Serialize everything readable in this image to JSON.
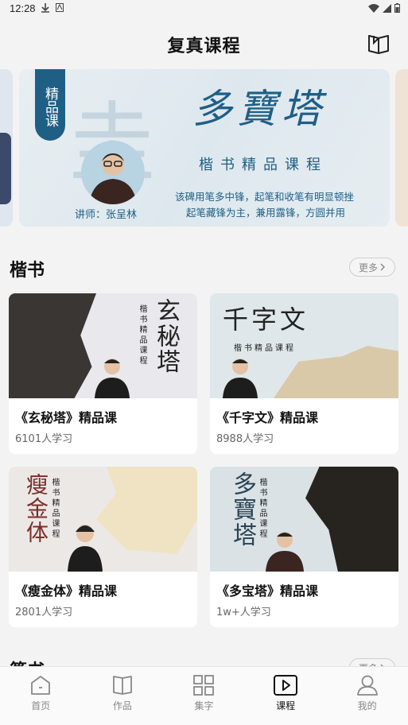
{
  "status_bar": {
    "time": "12:28"
  },
  "header": {
    "title": "复真课程"
  },
  "banner": {
    "tag": "精品课",
    "big_char": "圭",
    "title": "多寶塔",
    "subtitle": "楷书精品课程",
    "desc_line1": "该碑用笔多中锋，起笔和收笔有明显顿挫",
    "desc_line2": "起笔藏锋为主，兼用露锋，方圆并用",
    "teacher": "讲师：张呈林"
  },
  "sections": [
    {
      "title": "楷书",
      "more_label": "更多",
      "courses": [
        {
          "title": "《玄秘塔》精品课",
          "count": "6101人学习",
          "thumb_big": "玄秘塔",
          "thumb_small": "楷书精品课程",
          "thumb_bg": "#e9e9ed"
        },
        {
          "title": "《千字文》精品课",
          "count": "8988人学习",
          "thumb_big": "千字文",
          "thumb_small": "楷书精品课程",
          "thumb_bg": "#dfe7ea"
        },
        {
          "title": "《瘦金体》精品课",
          "count": "2801人学习",
          "thumb_big": "瘦金体",
          "thumb_small": "楷书精品课程",
          "thumb_bg": "#ece8e6"
        },
        {
          "title": "《多宝塔》精品课",
          "count": "1w+人学习",
          "thumb_big": "多寶塔",
          "thumb_small": "楷书精品课程",
          "thumb_bg": "#dbe2e6"
        }
      ]
    },
    {
      "title": "篆书",
      "more_label": "更多"
    }
  ],
  "bottom_nav": [
    {
      "label": "首页",
      "icon": "home-icon"
    },
    {
      "label": "作品",
      "icon": "book-open-icon"
    },
    {
      "label": "集字",
      "icon": "grid-icon"
    },
    {
      "label": "课程",
      "icon": "play-icon",
      "active": true
    },
    {
      "label": "我的",
      "icon": "user-icon"
    }
  ],
  "colors": {
    "accent": "#1f5f86",
    "background": "#f3f3f3",
    "muted": "#888888"
  }
}
